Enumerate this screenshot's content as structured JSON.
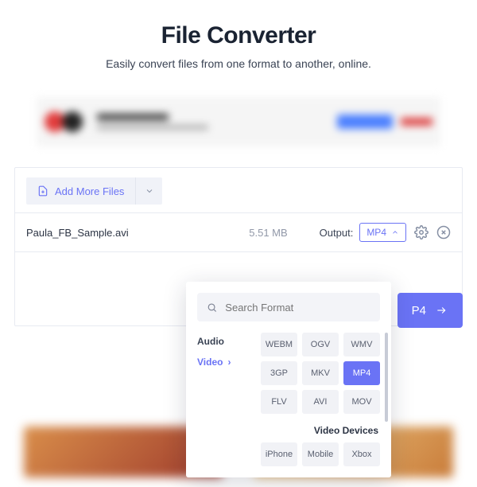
{
  "header": {
    "title": "File Converter",
    "subtitle": "Easily convert files from one format to another, online."
  },
  "toolbar": {
    "add_more_label": "Add More Files"
  },
  "file": {
    "name": "Paula_FB_Sample.avi",
    "size": "5.51 MB",
    "output_label": "Output:",
    "output_value": "MP4"
  },
  "convert": {
    "suffix": "P4"
  },
  "dropdown": {
    "search_placeholder": "Search Format",
    "categories": {
      "audio": "Audio",
      "video": "Video"
    },
    "formats": {
      "webm": "WEBM",
      "ogv": "OGV",
      "wmv": "WMV",
      "3gp": "3GP",
      "mkv": "MKV",
      "mp4": "MP4",
      "flv": "FLV",
      "avi": "AVI",
      "mov": "MOV"
    },
    "video_devices_label": "Video Devices",
    "devices": {
      "iphone": "iPhone",
      "mobile": "Mobile",
      "xbox": "Xbox"
    }
  }
}
